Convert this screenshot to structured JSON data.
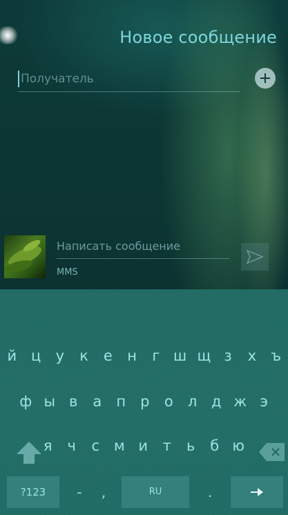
{
  "header": {
    "title": "Новое сообщение"
  },
  "recipient": {
    "placeholder": "Получатель"
  },
  "compose": {
    "placeholder": "Написать сообщение",
    "type_label": "MMS"
  },
  "keyboard": {
    "row1": [
      "й",
      "ц",
      "у",
      "к",
      "е",
      "н",
      "г",
      "ш",
      "щ",
      "з",
      "х",
      "ъ"
    ],
    "row2": [
      "ф",
      "ы",
      "в",
      "а",
      "п",
      "р",
      "о",
      "л",
      "д",
      "ж",
      "э"
    ],
    "row3": [
      "я",
      "ч",
      "с",
      "м",
      "и",
      "т",
      "ь",
      "б",
      "ю"
    ],
    "symbols_label": "?123",
    "dash_label": "-",
    "comma_label": ",",
    "space_label": "RU",
    "period_label": "."
  },
  "icons": {
    "add": "add-contact-icon",
    "send": "send-icon",
    "shift": "shift-icon",
    "backspace": "backspace-icon",
    "enter": "enter-arrow-icon"
  },
  "colors": {
    "accent": "#7ed6dc",
    "keyboard_bg": "#1f6a63"
  }
}
